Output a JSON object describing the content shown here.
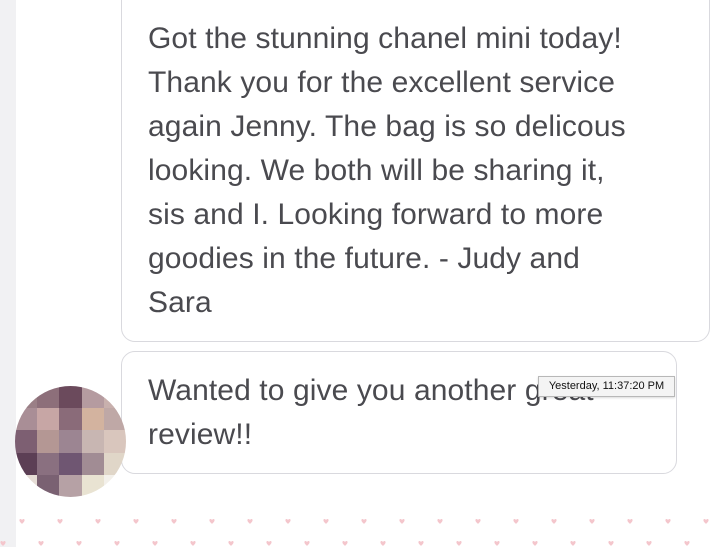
{
  "messages": [
    {
      "lines": [
        "Got the stunning chanel mini today!",
        "Thank you for the excellent service",
        "again Jenny. The bag is so delicous",
        "looking. We both will be sharing it,",
        "sis and I.  Looking forward to more",
        "goodies in the future.  - Judy and",
        "Sara"
      ]
    },
    {
      "lines": [
        "Wanted to give you another great",
        "review!!"
      ]
    }
  ],
  "tooltip": {
    "text": "Yesterday, 11:37:20 PM"
  },
  "avatar": {
    "icon": "pixelated-avatar-icon",
    "colors": [
      "#9a7f86",
      "#8d6f7a",
      "#6b4a5c",
      "#b59ba0",
      "#c8b0ad",
      "#a98e96",
      "#c7a6a5",
      "#8a6b79",
      "#d3b39f",
      "#bfa8a6",
      "#7d5f72",
      "#b49794",
      "#9c8592",
      "#c8b6b2",
      "#d9c6bd",
      "#5c3f55",
      "#8a7080",
      "#6f5672",
      "#a18c94",
      "#e0d6c8",
      "#e6ddd6",
      "#7a6172",
      "#b6a1a5",
      "#e9e3d2",
      "#f3f0ea"
    ]
  },
  "theme": {
    "bubble_border": "#d9d9de",
    "text_color": "#4a4a4f",
    "heart_color": "#f4c6cc"
  }
}
